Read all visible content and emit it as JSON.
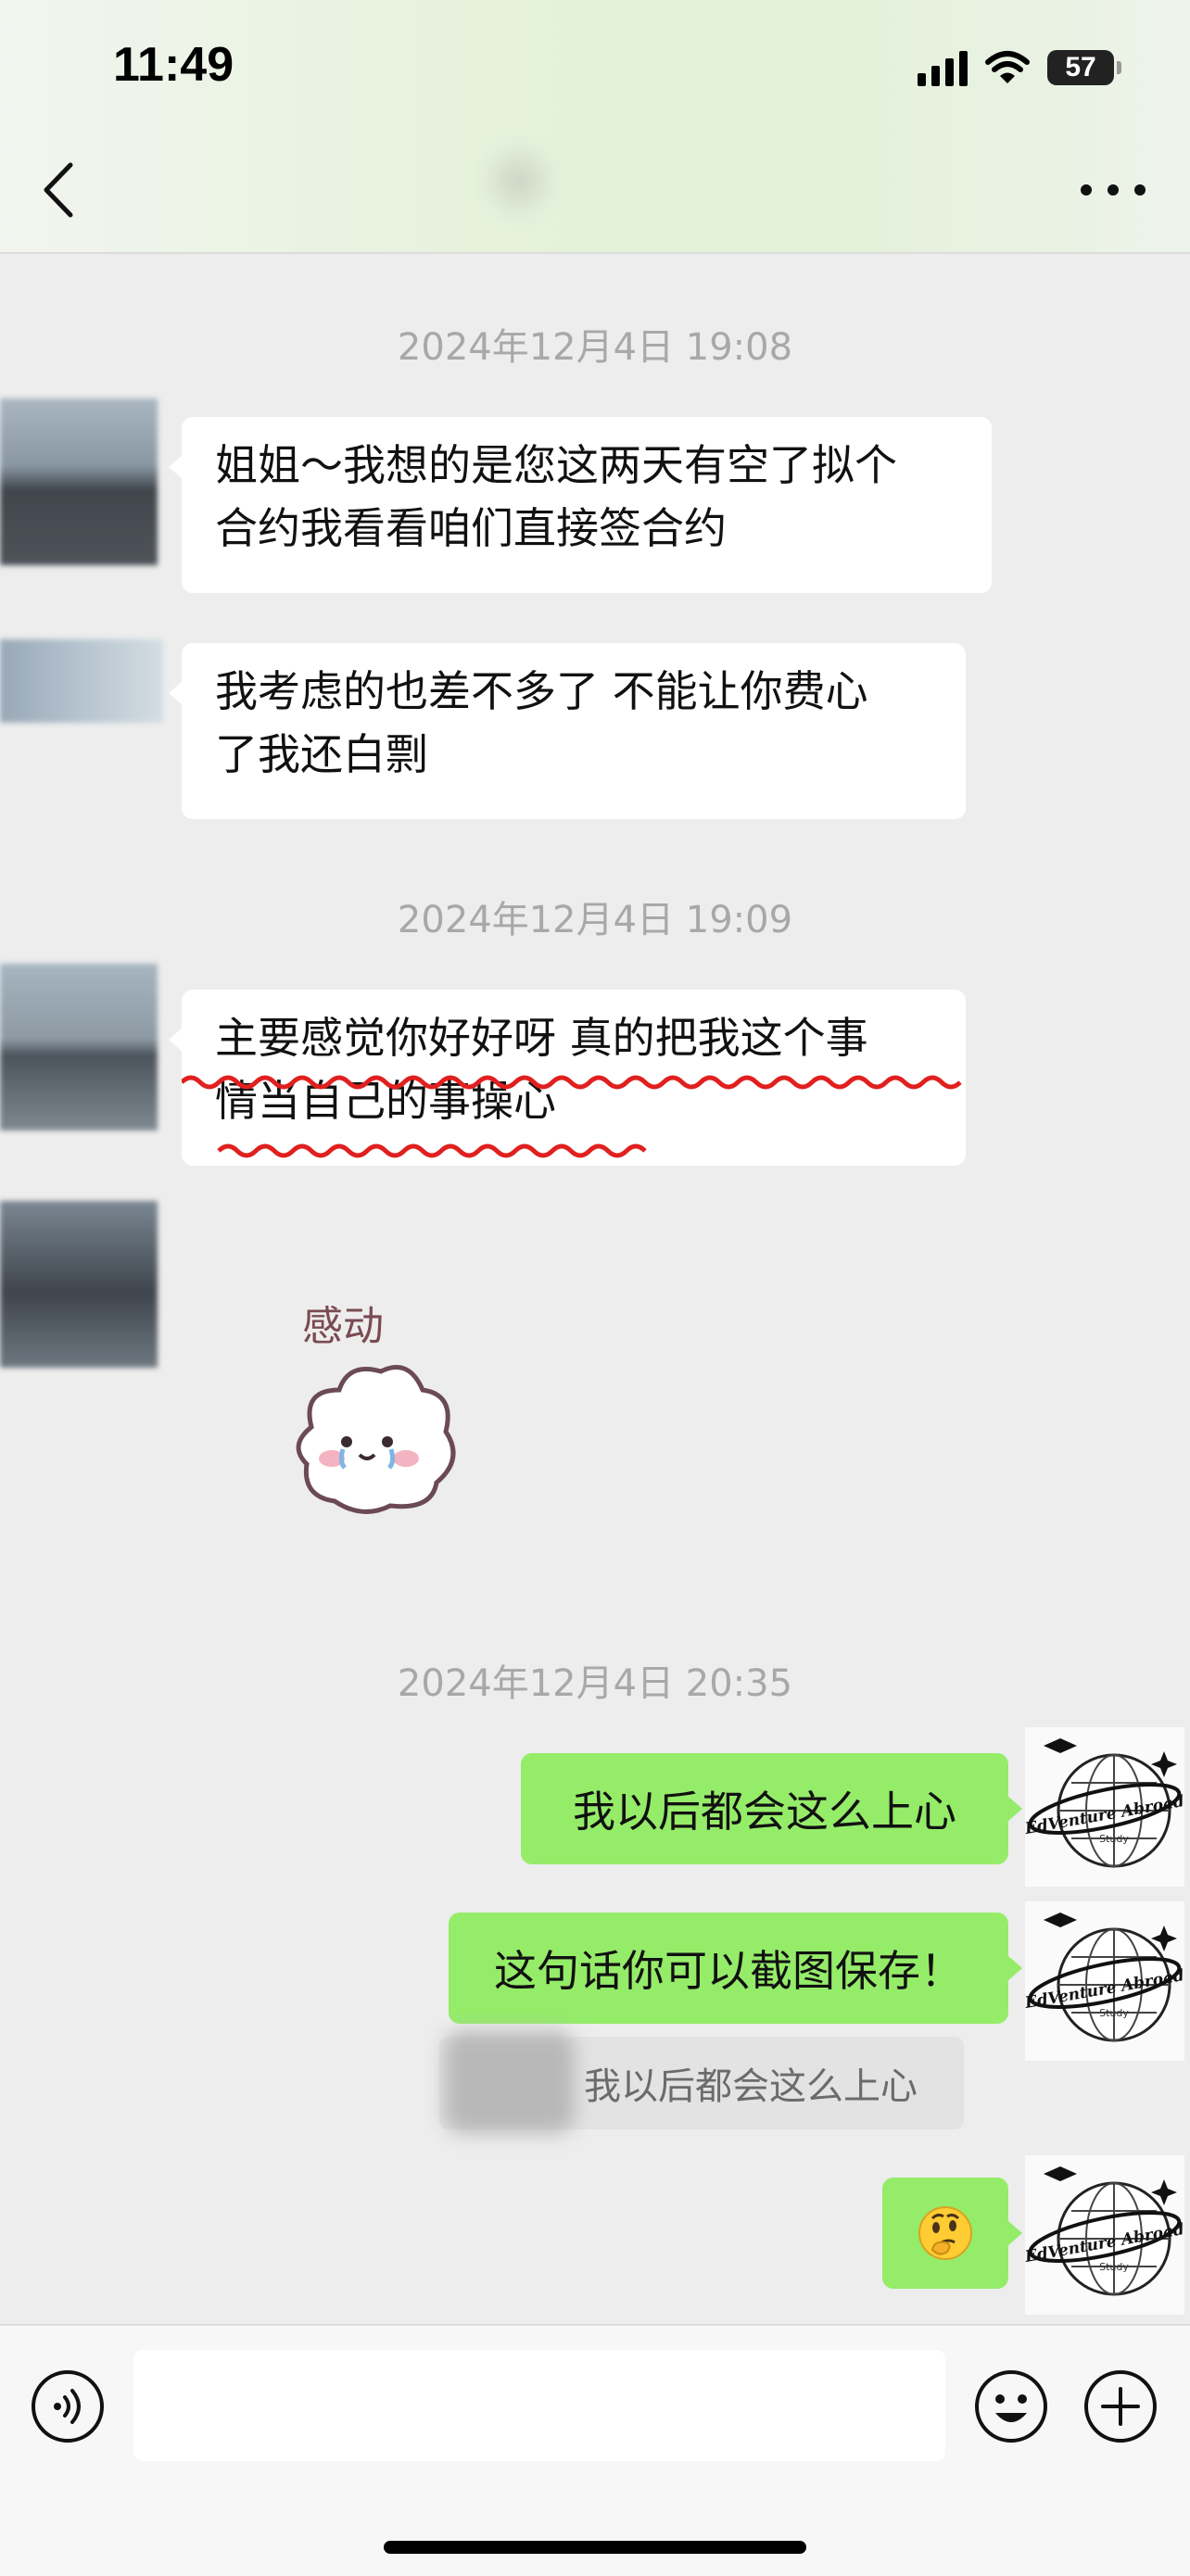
{
  "status_bar": {
    "time": "11:49",
    "battery": "57"
  },
  "chat": {
    "messages": [
      {
        "type": "timestamp",
        "text": "2024年12月4日 19:08"
      },
      {
        "type": "received",
        "text_line1": "姐姐～我想的是您这两天有空了拟个",
        "text_line2": "合约我看看咱们直接签合约"
      },
      {
        "type": "received",
        "text_line1": "我考虑的也差不多了 不能让你费心",
        "text_line2": "了我还白剽"
      },
      {
        "type": "timestamp",
        "text": "2024年12月4日 19:09"
      },
      {
        "type": "received",
        "text_line1": "主要感觉你好好呀 真的把我这个事",
        "text_line2": "情当自己的事操心"
      },
      {
        "type": "received_sticker",
        "sticker_text": "感动",
        "icon": "crying-cloud-sticker"
      },
      {
        "type": "timestamp",
        "text": "2024年12月4日 20:35"
      },
      {
        "type": "sent",
        "text": "我以后都会这么上心"
      },
      {
        "type": "sent",
        "text": "这句话你可以截图保存！",
        "quote": "我以后都会这么上心"
      },
      {
        "type": "sent_emoji",
        "icon": "thinking-face-emoji"
      }
    ],
    "my_avatar_text": "EdVenture Abroad",
    "my_avatar_subtext": "Study"
  },
  "icons": {
    "back": "chevron-left-icon",
    "more": "more-dots-icon",
    "voice": "voice-icon",
    "emoji": "emoji-icon",
    "plus": "plus-icon"
  },
  "colors": {
    "sent_bubble": "#95ec69",
    "received_bubble": "#ffffff",
    "background": "#ededed",
    "underline": "#e0201f"
  }
}
